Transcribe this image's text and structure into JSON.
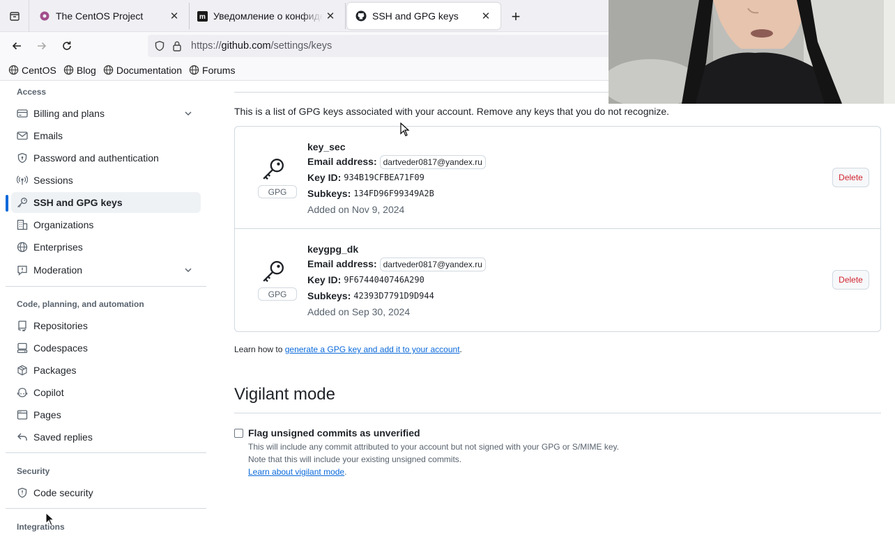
{
  "browser": {
    "tabs": [
      {
        "title": "The CentOS Project",
        "close": "✕"
      },
      {
        "title": "Уведомление о конфиденциальности",
        "close": "✕"
      },
      {
        "title": "SSH and GPG keys",
        "close": "✕"
      }
    ],
    "new_tab": "+",
    "url": {
      "prefix": "https://",
      "host": "github.com",
      "path": "/settings/keys"
    },
    "bookmarks": [
      "CentOS",
      "Blog",
      "Documentation",
      "Forums"
    ]
  },
  "sidebar": {
    "access_heading": "Access",
    "access_items": [
      {
        "label": "Billing and plans",
        "icon": "credit-card-icon",
        "expandable": true
      },
      {
        "label": "Emails",
        "icon": "mail-icon"
      },
      {
        "label": "Password and authentication",
        "icon": "shield-lock-icon"
      },
      {
        "label": "Sessions",
        "icon": "broadcast-icon"
      },
      {
        "label": "SSH and GPG keys",
        "icon": "key-icon",
        "active": true
      },
      {
        "label": "Organizations",
        "icon": "organization-icon"
      },
      {
        "label": "Enterprises",
        "icon": "globe-icon"
      },
      {
        "label": "Moderation",
        "icon": "report-icon",
        "expandable": true
      }
    ],
    "code_heading": "Code, planning, and automation",
    "code_items": [
      {
        "label": "Repositories",
        "icon": "repo-icon"
      },
      {
        "label": "Codespaces",
        "icon": "codespaces-icon"
      },
      {
        "label": "Packages",
        "icon": "package-icon"
      },
      {
        "label": "Copilot",
        "icon": "copilot-icon"
      },
      {
        "label": "Pages",
        "icon": "browser-icon"
      },
      {
        "label": "Saved replies",
        "icon": "reply-icon"
      }
    ],
    "security_heading": "Security",
    "security_items": [
      {
        "label": "Code security",
        "icon": "shield-icon"
      }
    ],
    "integrations_heading": "Integrations"
  },
  "gpg": {
    "intro": "This is a list of GPG keys associated with your account. Remove any keys that you do not recognize.",
    "badge": "GPG",
    "labels": {
      "email": "Email address:",
      "key_id": "Key ID:",
      "subkeys": "Subkeys:"
    },
    "keys": [
      {
        "name": "key_sec",
        "email": "dartveder0817@yandex.ru",
        "key_id": "934B19CFBEA71F09",
        "subkeys": "134FD96F99349A2B",
        "added": "Added on Nov 9, 2024",
        "delete": "Delete"
      },
      {
        "name": "keygpg_dk",
        "email": "dartveder0817@yandex.ru",
        "key_id": "9F6744040746A290",
        "subkeys": "42393D7791D9D944",
        "added": "Added on Sep 30, 2024",
        "delete": "Delete"
      }
    ],
    "learn_prefix": "Learn how to ",
    "learn_link": "generate a GPG key and add it to your account",
    "learn_suffix": "."
  },
  "vigilant": {
    "title": "Vigilant mode",
    "checkbox_label": "Flag unsigned commits as unverified",
    "checked": false,
    "note_1": "This will include any commit attributed to your account but not signed with your GPG or S/MIME key.",
    "note_2": "Note that this will include your existing unsigned commits.",
    "link": "Learn about vigilant mode",
    "link_suffix": "."
  },
  "colors": {
    "accent": "#0969da",
    "danger": "#d1242f",
    "muted": "#59636e",
    "border": "#d1d9e0"
  }
}
